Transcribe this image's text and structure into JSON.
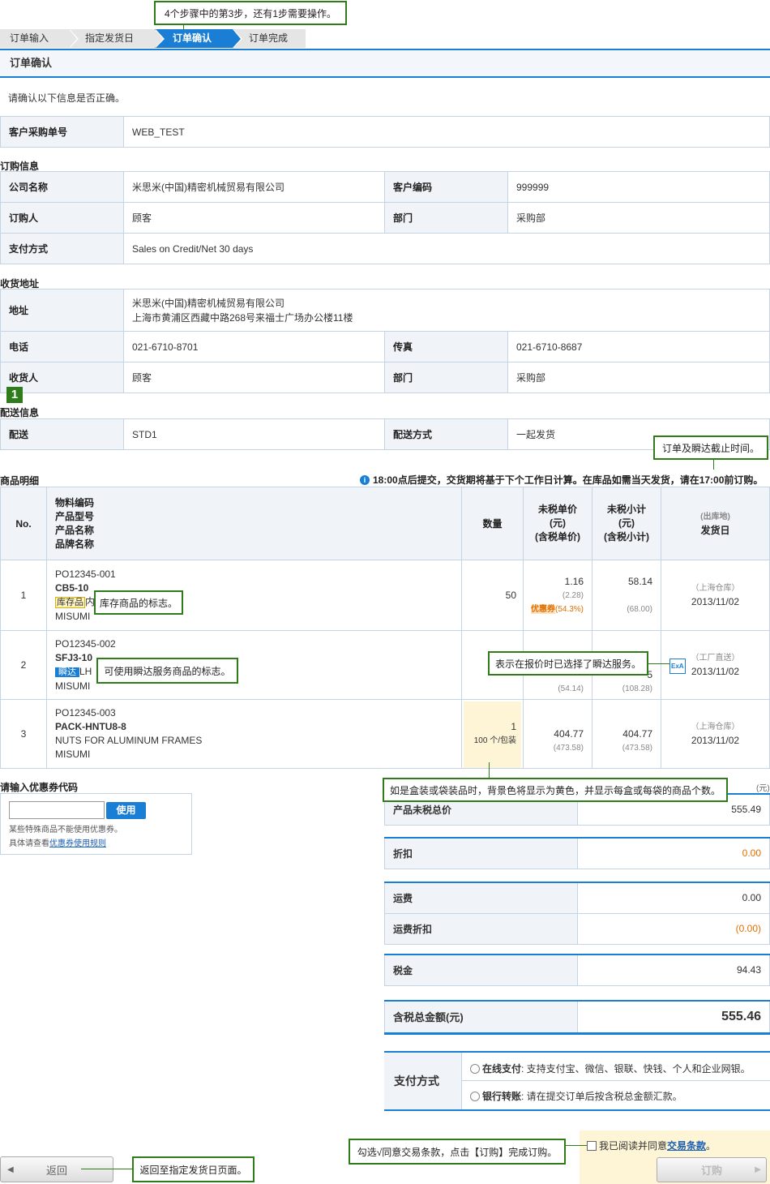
{
  "callouts": {
    "step": "4个步骤中的第3步，还有1步需要操作。",
    "stock": "库存商品的标志。",
    "express": "可使用瞬达服务商品的标志。",
    "deadline": "订单及瞬达截止时间。",
    "quote_express": "表示在报价时已选择了瞬达服务。",
    "box": "如是盒装或袋装品时，背景色将显示为黄色，并显示每盒或每袋的商品个数。",
    "agree": "勾选√同意交易条款，点击【订购】完成订购。",
    "back": "返回至指定发货日页面。"
  },
  "steps": [
    "订单输入",
    "指定发货日",
    "订单确认",
    "订单完成"
  ],
  "page_title": "订单确认",
  "confirm_msg": "请确认以下信息是否正确。",
  "po": {
    "label": "客户采购单号",
    "value": "WEB_TEST"
  },
  "order_info": {
    "title": "订购信息",
    "company_label": "公司名称",
    "company": "米思米(中国)精密机械贸易有限公司",
    "code_label": "客户编码",
    "code": "999999",
    "buyer_label": "订购人",
    "buyer": "顾客",
    "dept_label": "部门",
    "dept": "采购部",
    "pay_label": "支付方式",
    "pay": "Sales on Credit/Net 30 days"
  },
  "ship_addr": {
    "title": "收货地址",
    "addr_label": "地址",
    "addr1": "米思米(中国)精密机械贸易有限公司",
    "addr2": "上海市黄浦区西藏中路268号来福士广场办公楼11楼",
    "tel_label": "电话",
    "tel": "021-6710-8701",
    "fax_label": "传真",
    "fax": "021-6710-8687",
    "recv_label": "收货人",
    "recv": "顾客",
    "dept_label": "部门",
    "dept": "采购部"
  },
  "marker": "1",
  "delivery": {
    "title": "配送信息",
    "label": "配送",
    "value": "STD1",
    "method_label": "配送方式",
    "method": "一起发货"
  },
  "products": {
    "title": "商品明细",
    "notice": "18:00点后提交，交货期将基于下个工作日计算。在库品如需当天发货，请在17:00前订购。",
    "h_no": "No.",
    "h_info": [
      "物料编码",
      "产品型号",
      "产品名称",
      "品牌名称"
    ],
    "h_qty": "数量",
    "h_unit": [
      "未税单价",
      "(元)",
      "(含税单价)"
    ],
    "h_sub": [
      "未税小计",
      "(元)",
      "(含税小计)"
    ],
    "h_ship_small": "(出库地)",
    "h_ship": "发货日",
    "rows": [
      {
        "no": "1",
        "code": "PO12345-001",
        "model": "CB5-10",
        "badge": "库存品",
        "name": "内",
        "brand": "MISUMI",
        "qty": "50",
        "unit": "1.16",
        "unit_tax": "(2.28)",
        "coupon": "优惠券",
        "coupon_pct": "(54.3%)",
        "sub": "58.14",
        "sub_tax": "(68.00)",
        "wh": "（上海仓库）",
        "date": "2013/11/02"
      },
      {
        "no": "2",
        "code": "PO12345-002",
        "model": "SFJ3-10",
        "badge": "瞬达",
        "name": "LH",
        "brand": "MISUMI",
        "qty": "",
        "unit": "",
        "unit_tax": "(54.14)",
        "sub": "5",
        "sub_tax": "(108.28)",
        "ex": "ExA",
        "wh": "（工厂直送）",
        "date": "2013/11/02"
      },
      {
        "no": "3",
        "code": "PO12345-003",
        "model": "PACK-HNTU8-8",
        "name": "NUTS FOR ALUMINUM FRAMES",
        "brand": "MISUMI",
        "qty": "1",
        "qty_sub": "100 个/包装",
        "unit": "404.77",
        "unit_tax": "(473.58)",
        "sub": "404.77",
        "sub_tax": "(473.58)",
        "wh": "（上海仓库）",
        "date": "2013/11/02"
      }
    ]
  },
  "coupon": {
    "title": "请输入优惠券代码",
    "placeholder": "",
    "button": "使用",
    "note1": "某些特殊商品不能使用优惠券。",
    "note2": "具体请查看",
    "link": "优惠券使用规则"
  },
  "summary": {
    "unit": "(元)",
    "subtotal_label": "产品未税总价",
    "subtotal": "555.49",
    "discount_label": "折扣",
    "discount": "0.00",
    "freight_label": "运费",
    "freight": "0.00",
    "freight_disc_label": "运费折扣",
    "freight_disc": "(0.00)",
    "tax_label": "税金",
    "tax": "94.43",
    "total_label": "含税总金额(元)",
    "total": "555.46"
  },
  "payment": {
    "label": "支付方式",
    "opt1_b": "在线支付",
    "opt1": ": 支持支付宝、微信、银联、快钱、个人和企业网银。",
    "opt2_b": "银行转账",
    "opt2": ": 请在提交订单后按含税总金额汇款。"
  },
  "agree": {
    "text": "我已阅读并同意",
    "link": "交易条款",
    "tail": "。"
  },
  "buttons": {
    "back": "返回",
    "order": "订购"
  },
  "colors": {
    "accent": "#1a7fd4",
    "callout": "#2e7d1a",
    "highlight": "#fdf5d6",
    "orange": "#e07000"
  }
}
